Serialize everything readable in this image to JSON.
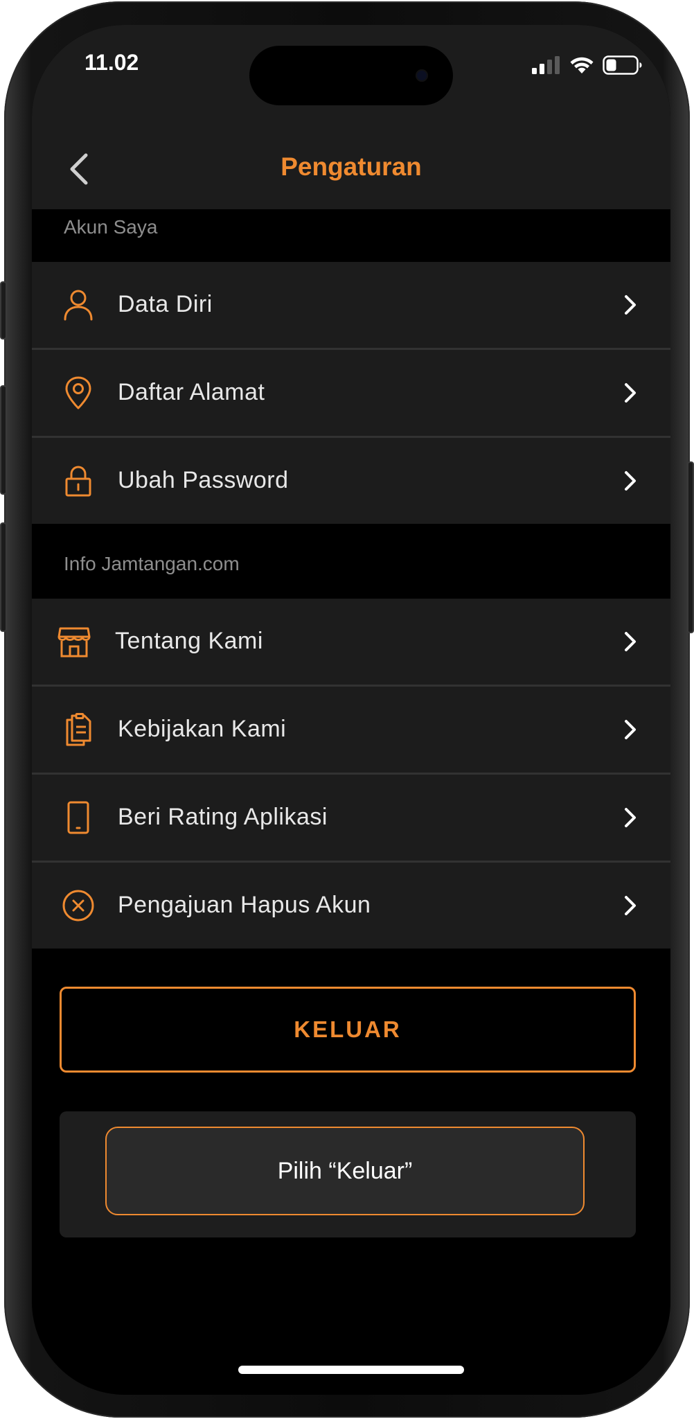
{
  "status_bar": {
    "time": "11.02"
  },
  "header": {
    "title": "Pengaturan",
    "back_icon": "chevron-left-icon"
  },
  "sections": {
    "account": {
      "label": "Akun Saya",
      "items": [
        {
          "label": "Data Diri",
          "icon": "person-icon"
        },
        {
          "label": "Daftar Alamat",
          "icon": "location-pin-icon"
        },
        {
          "label": "Ubah Password",
          "icon": "lock-icon"
        }
      ]
    },
    "info": {
      "label": "Info Jamtangan.com",
      "items": [
        {
          "label": "Tentang Kami",
          "icon": "store-icon"
        },
        {
          "label": "Kebijakan Kami",
          "icon": "clipboard-icon"
        },
        {
          "label": "Beri Rating Aplikasi",
          "icon": "phone-icon"
        },
        {
          "label": "Pengajuan Hapus Akun",
          "icon": "circle-x-icon"
        }
      ]
    }
  },
  "logout_button": {
    "label": "KELUAR"
  },
  "tooltip": {
    "text": "Pilih “Keluar”"
  },
  "colors": {
    "accent": "#ef8a30",
    "background": "#000000",
    "surface": "#1c1c1c",
    "divider": "#323232",
    "section_label": "#8e8e8e"
  }
}
